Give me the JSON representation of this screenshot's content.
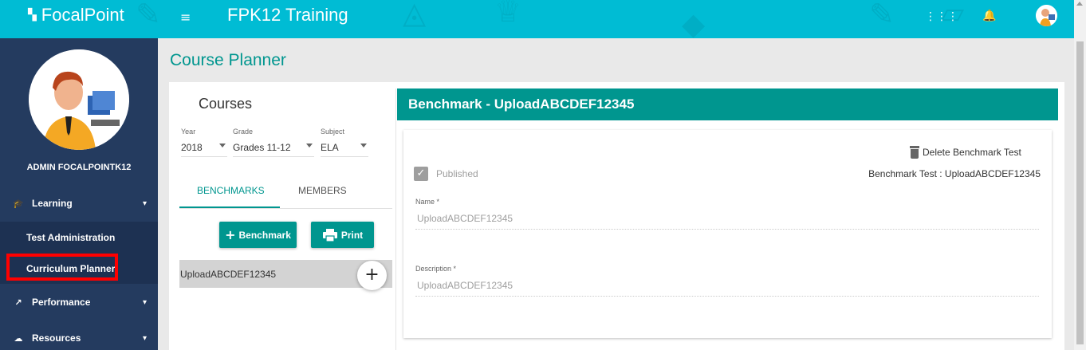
{
  "header": {
    "logo_text": "FocalPoint",
    "app_title": "FPK12 Training"
  },
  "sidebar": {
    "user_name": "ADMIN FOCALPOINTK12",
    "items": [
      {
        "label": "Learning",
        "icon": "graduation-cap-icon"
      },
      {
        "label": "Performance",
        "icon": "trending-up-icon"
      },
      {
        "label": "Resources",
        "icon": "cloud-download-icon"
      }
    ],
    "sub_items": [
      {
        "label": "Test Administration"
      },
      {
        "label": "Curriculum Planner"
      }
    ]
  },
  "page": {
    "title": "Course Planner"
  },
  "courses": {
    "title": "Courses",
    "filters": [
      {
        "label": "Year",
        "value": "2018"
      },
      {
        "label": "Grade",
        "value": "Grades 11-12"
      },
      {
        "label": "Subject",
        "value": "ELA"
      }
    ],
    "tabs": [
      {
        "label": "BENCHMARKS"
      },
      {
        "label": "MEMBERS"
      }
    ],
    "active_tab": "BENCHMARKS",
    "add_button_label": "Benchmark",
    "print_button_label": "Print",
    "list": [
      {
        "label": "UploadABCDEF12345"
      }
    ]
  },
  "benchmark": {
    "header_title": "Benchmark - UploadABCDEF12345",
    "delete_label": "Delete Benchmark Test",
    "published_label": "Published",
    "published_checked": true,
    "info_text": "Benchmark Test : UploadABCDEF12345",
    "name_label": "Name *",
    "name_value": "UploadABCDEF12345",
    "description_label": "Description *",
    "description_value": "UploadABCDEF12345"
  },
  "colors": {
    "header_bg": "#00bcd4",
    "sidebar_bg": "#243b5f",
    "accent": "#00968f",
    "highlight": "#ff0000"
  }
}
